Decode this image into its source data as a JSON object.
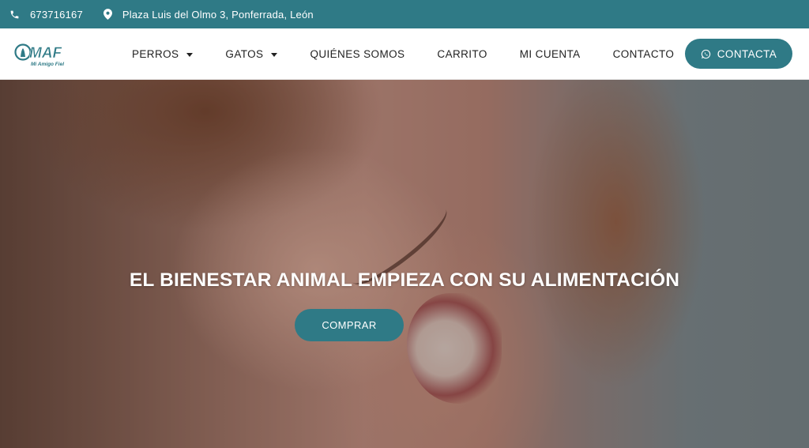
{
  "topbar": {
    "phone": "673716167",
    "address": "Plaza Luis del Olmo 3, Ponferrada, León",
    "background_color": "#2f7a86"
  },
  "header": {
    "logo_text": "MAF",
    "logo_tagline": "Mi Amigo Fiel",
    "nav": [
      {
        "label": "PERROS",
        "has_dropdown": true
      },
      {
        "label": "GATOS",
        "has_dropdown": true
      },
      {
        "label": "QUIÉNES SOMOS",
        "has_dropdown": false
      },
      {
        "label": "CARRITO",
        "has_dropdown": false
      },
      {
        "label": "MI CUENTA",
        "has_dropdown": false
      },
      {
        "label": "CONTACTO",
        "has_dropdown": false
      }
    ],
    "cta_label": "CONTACTA",
    "cta_icon": "whatsapp-icon"
  },
  "hero": {
    "title": "EL BIENESTAR ANIMAL EMPIEZA CON SU ALIMENTACIÓN",
    "button_label": "COMPRAR"
  },
  "colors": {
    "accent": "#2f7a86",
    "text": "#222222"
  }
}
